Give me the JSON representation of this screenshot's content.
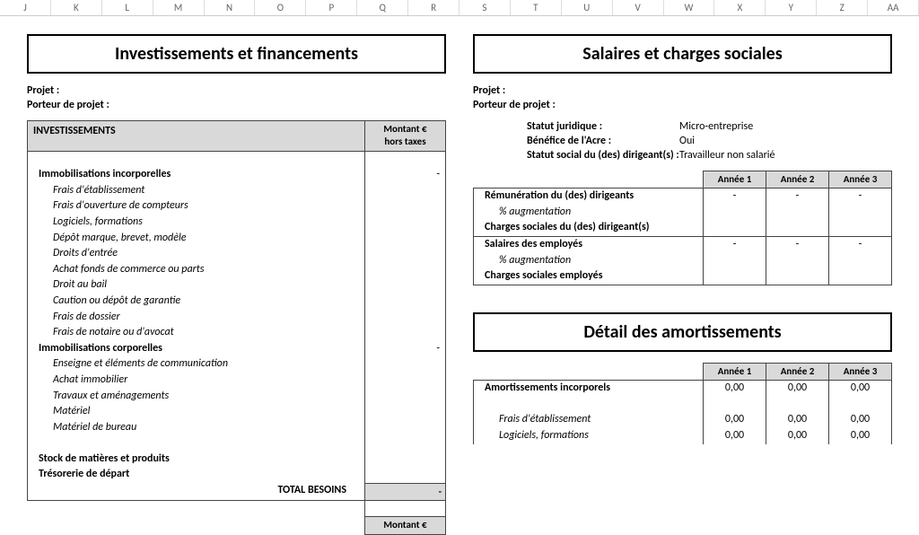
{
  "columns": [
    "J",
    "K",
    "L",
    "M",
    "N",
    "O",
    "P",
    "Q",
    "R",
    "S",
    "T",
    "U",
    "V",
    "W",
    "X",
    "Y",
    "Z",
    "AA"
  ],
  "left": {
    "title": "Investissements et financements",
    "project_label": "Projet :",
    "owner_label": "Porteur de projet :",
    "section_header": "INVESTISSEMENTS",
    "amount_header_l1": "Montant €",
    "amount_header_l2": "hors taxes",
    "rows": [
      {
        "label": "Immobilisations incorporelles",
        "bold": true,
        "value": "-"
      },
      {
        "label": "Frais d'établissement",
        "ital": true
      },
      {
        "label": "Frais d'ouverture de compteurs",
        "ital": true
      },
      {
        "label": "Logiciels, formations",
        "ital": true
      },
      {
        "label": "Dépôt marque, brevet, modèle",
        "ital": true
      },
      {
        "label": "Droits d'entrée",
        "ital": true
      },
      {
        "label": "Achat fonds de commerce ou parts",
        "ital": true
      },
      {
        "label": "Droit au bail",
        "ital": true
      },
      {
        "label": "Caution ou dépôt de garantie",
        "ital": true
      },
      {
        "label": "Frais de dossier",
        "ital": true
      },
      {
        "label": "Frais de notaire ou d'avocat",
        "ital": true
      },
      {
        "label": "Immobilisations corporelles",
        "bold": true,
        "value": "-"
      },
      {
        "label": "Enseigne et éléments de communication",
        "ital": true
      },
      {
        "label": "Achat immobilier",
        "ital": true
      },
      {
        "label": "Travaux et aménagements",
        "ital": true
      },
      {
        "label": "Matériel",
        "ital": true
      },
      {
        "label": "Matériel de bureau",
        "ital": true
      }
    ],
    "stock_label": "Stock de matières et produits",
    "treso_label": "Trésorerie de départ",
    "total_label": "TOTAL BESOINS",
    "total_value": "-",
    "amount_footer": "Montant €"
  },
  "right": {
    "title1": "Salaires et charges sociales",
    "project_label": "Projet :",
    "owner_label": "Porteur de projet :",
    "status": [
      {
        "k": "Statut juridique :",
        "v": "Micro-entreprise"
      },
      {
        "k": "Bénéfice de l'Acre :",
        "v": "Oui"
      },
      {
        "k": "Statut social du (des) dirigeant(s) :",
        "v": "Travailleur non salarié"
      }
    ],
    "year1": "Année 1",
    "year2": "Année 2",
    "year3": "Année 3",
    "salary_rows": [
      {
        "label": "Rémunération du (des) dirigeants",
        "bold": true,
        "v1": "-",
        "v2": "-",
        "v3": "-"
      },
      {
        "label": "% augmentation",
        "ital": true
      },
      {
        "label": "Charges sociales du (des) dirigeant(s)",
        "bold": true,
        "sep": true
      },
      {
        "label": "Salaires des employés",
        "bold": true,
        "v1": "-",
        "v2": "-",
        "v3": "-"
      },
      {
        "label": "% augmentation",
        "ital": true
      },
      {
        "label": "Charges sociales employés",
        "bold": true
      }
    ],
    "title2": "Détail des amortissements",
    "amort_rows": [
      {
        "label": "Amortissements incorporels",
        "bold": true,
        "v1": "0,00",
        "v2": "0,00",
        "v3": "0,00"
      },
      {
        "label": "",
        "blank": true
      },
      {
        "label": "Frais d'établissement",
        "ital": true,
        "v1": "0,00",
        "v2": "0,00",
        "v3": "0,00"
      },
      {
        "label": "Logiciels, formations",
        "ital": true,
        "v1": "0,00",
        "v2": "0,00",
        "v3": "0,00"
      }
    ]
  }
}
